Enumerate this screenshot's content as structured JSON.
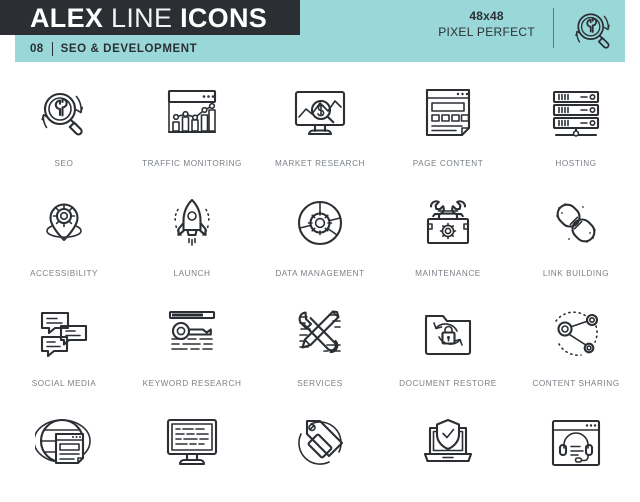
{
  "header": {
    "brand_bold_1": "ALEX",
    "brand_light": "LINE",
    "brand_bold_2": "ICONS",
    "set_number": "08",
    "set_title": "SEO & DEVELOPMENT",
    "pixel_size": "48x48",
    "pixel_perfect": "PIXEL PERFECT",
    "logo_icon": "magnifier-wrench-icon",
    "colors": {
      "teal": "#9ad7d8",
      "dark": "#2b2f33",
      "label": "#7a7f85",
      "white": "#ffffff"
    }
  },
  "grid": {
    "rows": [
      {
        "cells": [
          {
            "label": "SEO",
            "icon": "magnifier-wrench-icon"
          },
          {
            "label": "TRAFFIC MONITORING",
            "icon": "browser-bar-chart-icon"
          },
          {
            "label": "MARKET RESEARCH",
            "icon": "monitor-dollar-magnifier-icon"
          },
          {
            "label": "PAGE CONTENT",
            "icon": "webpage-layout-icon"
          },
          {
            "label": "HOSTING",
            "icon": "server-rack-icon"
          }
        ]
      },
      {
        "cells": [
          {
            "label": "ACCESSIBILITY",
            "icon": "map-pin-gear-icon"
          },
          {
            "label": "LAUNCH",
            "icon": "rocket-icon"
          },
          {
            "label": "DATA MANAGEMENT",
            "icon": "pie-chart-gear-icon"
          },
          {
            "label": "MAINTENANCE",
            "icon": "toolbox-wrench-icon"
          },
          {
            "label": "LINK BUILDING",
            "icon": "chain-link-icon"
          }
        ]
      },
      {
        "cells": [
          {
            "label": "SOCIAL MEDIA",
            "icon": "chat-bubbles-icon"
          },
          {
            "label": "KEYWORD RESEARCH",
            "icon": "key-document-icon"
          },
          {
            "label": "SERVICES",
            "icon": "pencil-wrench-icon"
          },
          {
            "label": "DOCUMENT RESTORE",
            "icon": "folder-lock-refresh-icon"
          },
          {
            "label": "CONTENT SHARING",
            "icon": "share-nodes-icon"
          }
        ]
      },
      {
        "cells": [
          {
            "label": "",
            "icon": "globe-webpage-icon"
          },
          {
            "label": "",
            "icon": "monitor-text-icon"
          },
          {
            "label": "",
            "icon": "price-tags-icon"
          },
          {
            "label": "",
            "icon": "laptop-shield-icon"
          },
          {
            "label": "",
            "icon": "browser-support-headset-icon"
          }
        ]
      }
    ]
  }
}
